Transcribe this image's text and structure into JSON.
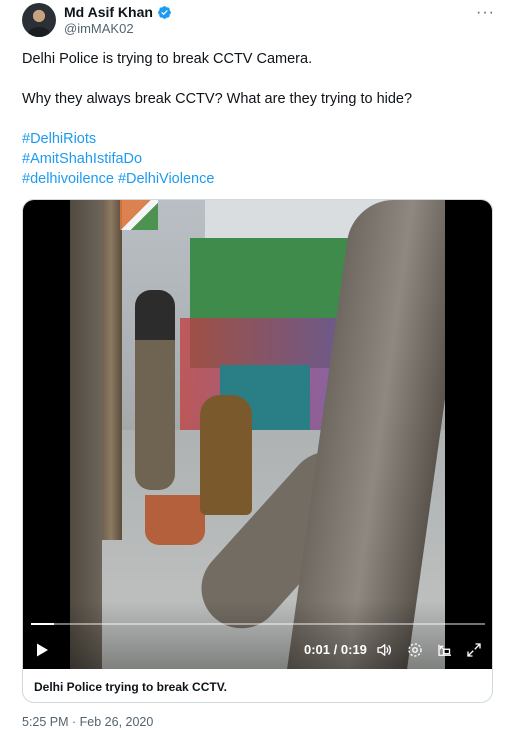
{
  "author": {
    "display_name": "Md Asif Khan",
    "handle": "@imMAK02",
    "verified": true
  },
  "tweet": {
    "line1": "Delhi Police is trying to break CCTV Camera.",
    "line2": "Why they always break CCTV? What are they trying to hide?",
    "hashtags": [
      "#DelhiRiots",
      "#AmitShahIstifaDo",
      "#delhivoilence",
      "#DelhiViolence"
    ],
    "timestamp": "5:25 PM · Feb 26, 2020"
  },
  "video": {
    "current_time": "0:01",
    "duration": "0:19",
    "time_display": "0:01 / 0:19",
    "progress_fraction": 0.05,
    "caption": "Delhi Police trying to break CCTV."
  },
  "colors": {
    "link": "#1d9bf0",
    "verified": "#1d9bf0",
    "secondary_text": "#536471"
  },
  "icons": [
    "more-icon",
    "verified-icon",
    "play-icon",
    "volume-icon",
    "settings-icon",
    "pip-icon",
    "fullscreen-icon"
  ]
}
